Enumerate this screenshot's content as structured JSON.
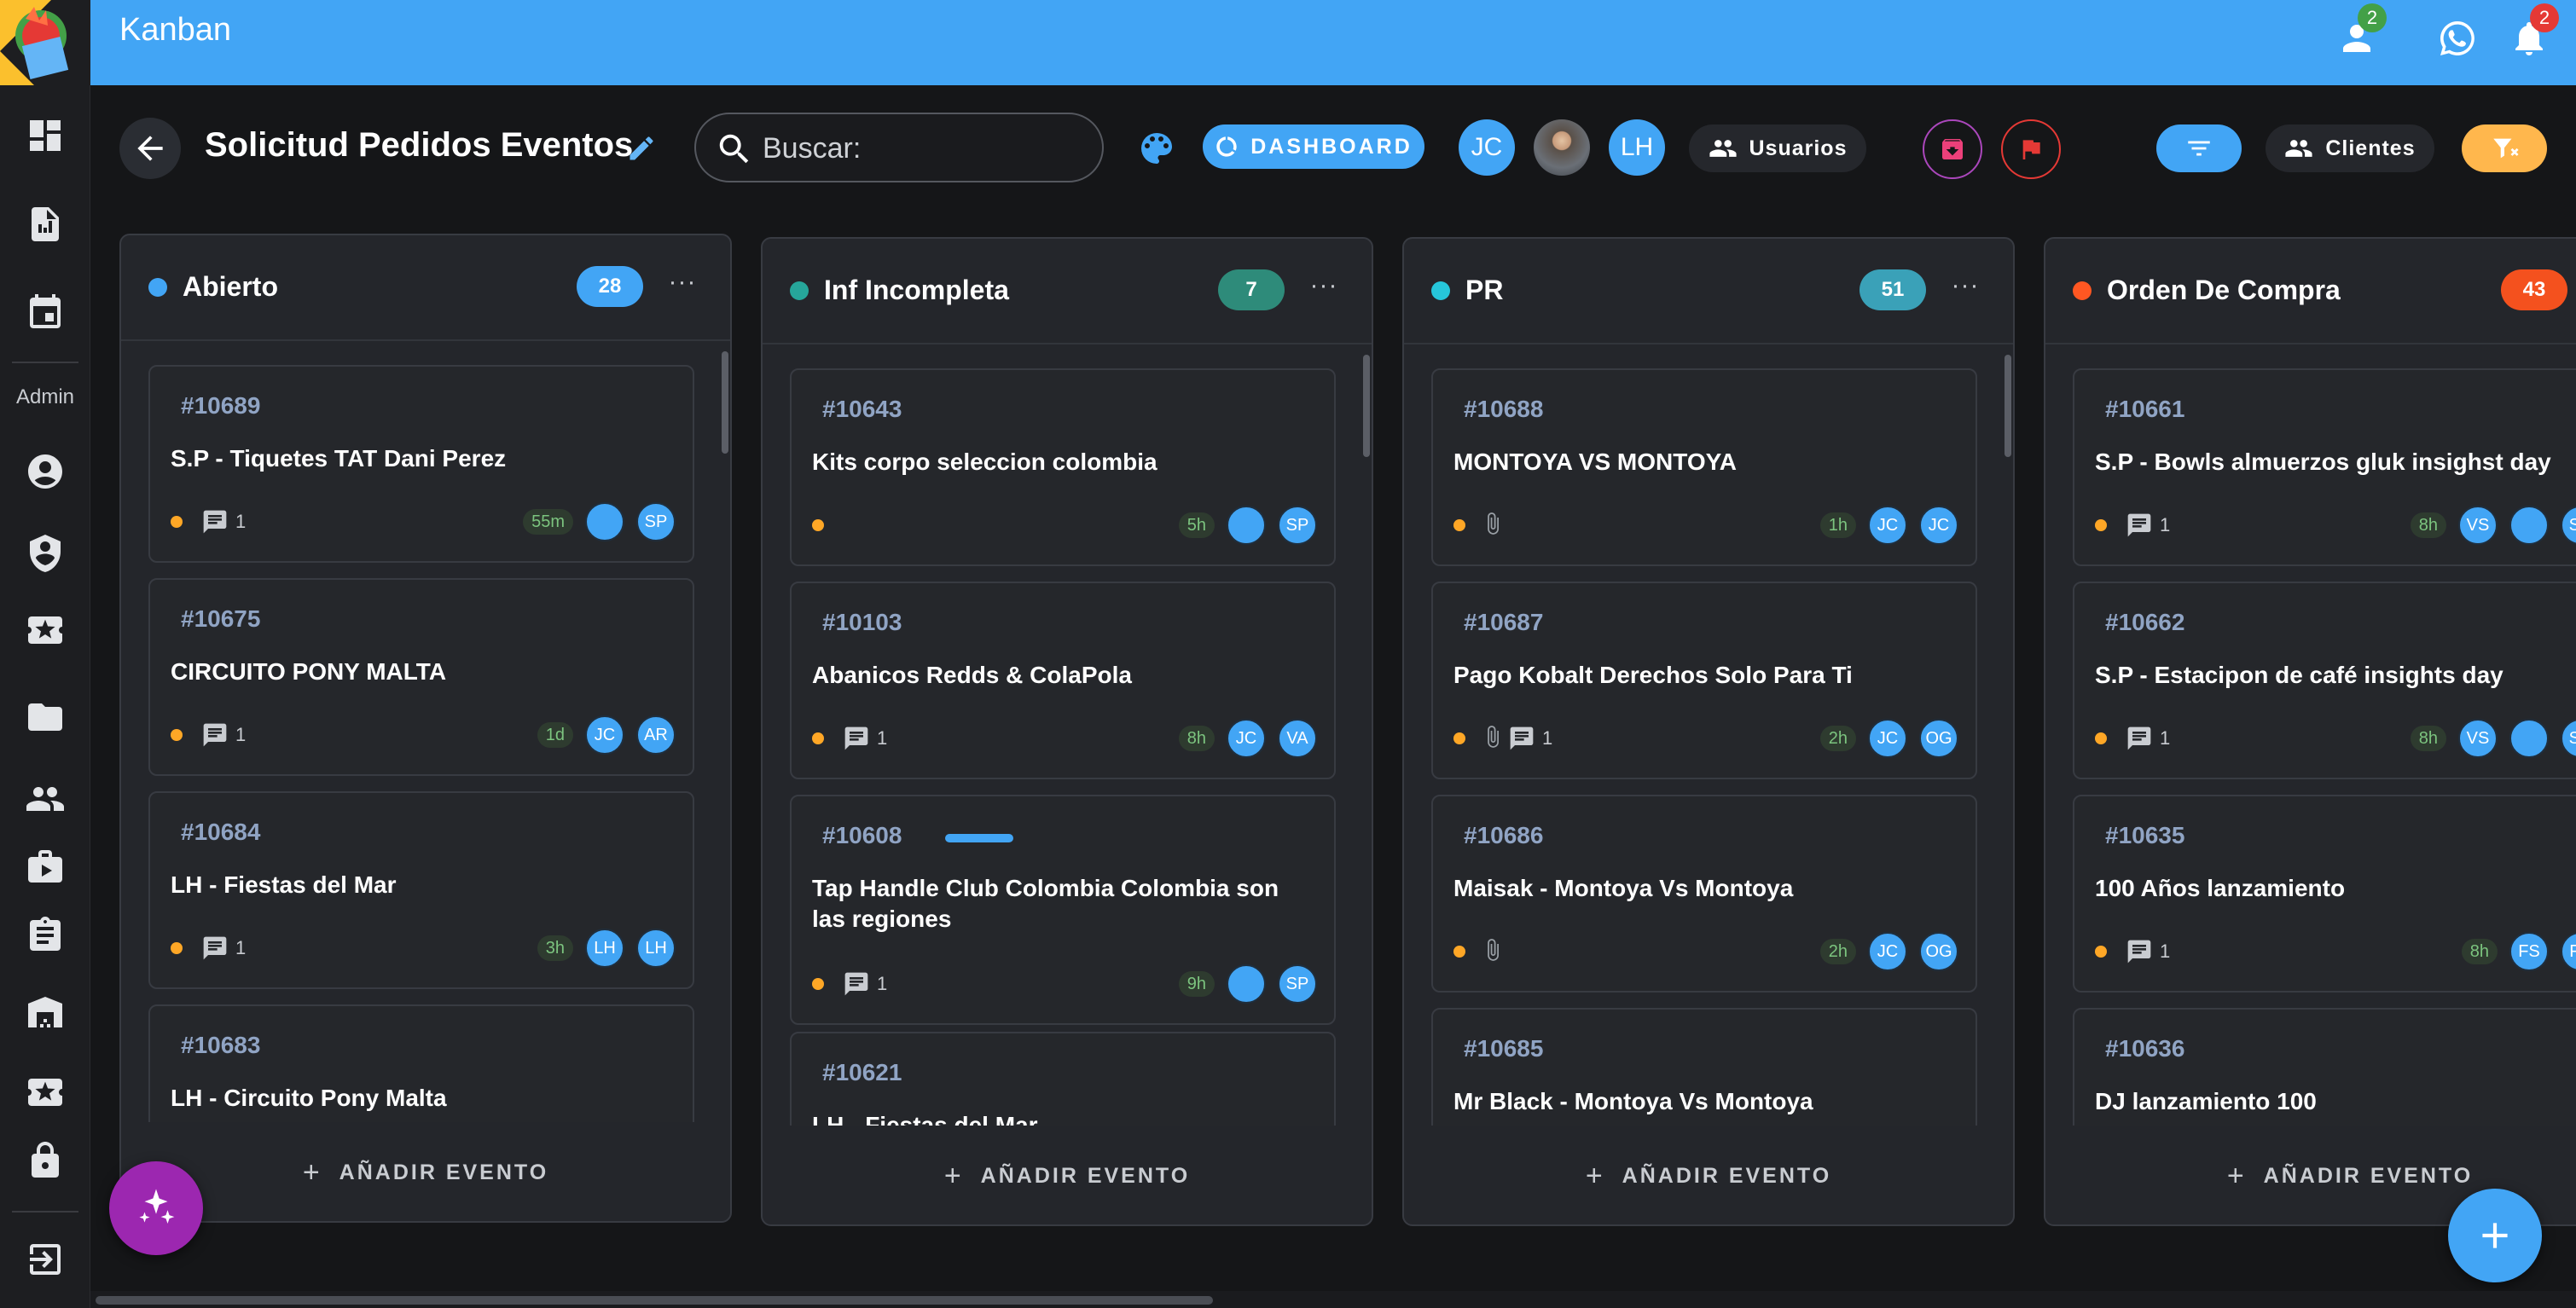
{
  "appbar": {
    "title": "Kanban",
    "contacts_badge": "2",
    "notifications_badge": "2"
  },
  "sidebar": {
    "admin_label": "Admin"
  },
  "toolbar": {
    "board_title": "Solicitud Pedidos Eventos",
    "search_placeholder": "Buscar:",
    "dashboard_label": "DASHBOARD",
    "users_label": "Usuarios",
    "clients_label": "Clientes",
    "avatars": [
      {
        "initials": "JC",
        "kind": "initials"
      },
      {
        "initials": "",
        "kind": "photo"
      },
      {
        "initials": "LH",
        "kind": "initials"
      }
    ]
  },
  "colors": {
    "accent": "#42a5f5",
    "col_abierto": "#42a5f5",
    "col_inf": "#26a69a",
    "col_pr": "#26c6da",
    "col_orden": "#ff5722",
    "priority": "#ffa726"
  },
  "add_label": "AÑADIR EVENTO",
  "columns": [
    {
      "title": "Abierto",
      "count": "28",
      "dot_color": "#42a5f5",
      "count_color": "#42a5f5",
      "cards": [
        {
          "id": "#10689",
          "title": "S.P - Tiquetes TAT Dani Perez",
          "comments": "1",
          "attachment": false,
          "bar": false,
          "age": "55m",
          "avatars": [
            {
              "kind": "photo",
              "initials": ""
            },
            {
              "kind": "initials",
              "initials": "SP"
            }
          ]
        },
        {
          "id": "#10675",
          "title": "CIRCUITO PONY MALTA",
          "comments": "1",
          "attachment": false,
          "bar": false,
          "age": "1d",
          "avatars": [
            {
              "kind": "initials",
              "initials": "JC"
            },
            {
              "kind": "initials",
              "initials": "AR"
            }
          ]
        },
        {
          "id": "#10684",
          "title": "LH - Fiestas del Mar",
          "comments": "1",
          "attachment": false,
          "bar": false,
          "age": "3h",
          "avatars": [
            {
              "kind": "initials",
              "initials": "LH"
            },
            {
              "kind": "initials",
              "initials": "LH"
            }
          ]
        },
        {
          "id": "#10683",
          "title": "LH - Circuito Pony Malta",
          "comments": "",
          "attachment": false,
          "bar": false,
          "age": "",
          "avatars": []
        }
      ]
    },
    {
      "title": "Inf Incompleta",
      "count": "7",
      "dot_color": "#26a69a",
      "count_color": "#2e8b7a",
      "cards": [
        {
          "id": "#10643",
          "title": "Kits corpo seleccion colombia",
          "comments": "",
          "attachment": false,
          "bar": false,
          "age": "5h",
          "avatars": [
            {
              "kind": "photo",
              "initials": ""
            },
            {
              "kind": "initials",
              "initials": "SP"
            }
          ]
        },
        {
          "id": "#10103",
          "title": "Abanicos Redds & ColaPola",
          "comments": "1",
          "attachment": false,
          "bar": false,
          "age": "8h",
          "avatars": [
            {
              "kind": "initials",
              "initials": "JC"
            },
            {
              "kind": "initials",
              "initials": "VA"
            }
          ]
        },
        {
          "id": "#10608",
          "title": "Tap Handle Club Colombia Colombia son las regiones",
          "comments": "1",
          "attachment": false,
          "bar": true,
          "age": "9h",
          "avatars": [
            {
              "kind": "photo",
              "initials": ""
            },
            {
              "kind": "initials",
              "initials": "SP"
            }
          ]
        },
        {
          "id": "#10621",
          "title": "LH - Fiestas del Mar",
          "comments": "",
          "attachment": false,
          "bar": false,
          "age": "",
          "avatars": []
        }
      ]
    },
    {
      "title": "PR",
      "count": "51",
      "dot_color": "#26c6da",
      "count_color": "#3aa1b8",
      "cards": [
        {
          "id": "#10688",
          "title": "MONTOYA VS MONTOYA",
          "comments": "",
          "attachment": true,
          "bar": false,
          "age": "1h",
          "avatars": [
            {
              "kind": "initials",
              "initials": "JC"
            },
            {
              "kind": "initials",
              "initials": "JC"
            }
          ]
        },
        {
          "id": "#10687",
          "title": "Pago Kobalt Derechos Solo Para Ti",
          "comments": "1",
          "attachment": true,
          "bar": false,
          "age": "2h",
          "avatars": [
            {
              "kind": "initials",
              "initials": "JC"
            },
            {
              "kind": "initials",
              "initials": "OG"
            }
          ]
        },
        {
          "id": "#10686",
          "title": "Maisak - Montoya Vs Montoya",
          "comments": "",
          "attachment": true,
          "bar": false,
          "age": "2h",
          "avatars": [
            {
              "kind": "initials",
              "initials": "JC"
            },
            {
              "kind": "initials",
              "initials": "OG"
            }
          ]
        },
        {
          "id": "#10685",
          "title": "Mr Black - Montoya Vs Montoya",
          "comments": "",
          "attachment": false,
          "bar": false,
          "age": "",
          "avatars": []
        }
      ]
    },
    {
      "title": "Orden De Compra",
      "count": "43",
      "dot_color": "#ff5722",
      "count_color": "#f4511e",
      "cards": [
        {
          "id": "#10661",
          "title": "S.P - Bowls almuerzos gluk insighst day",
          "comments": "1",
          "attachment": false,
          "bar": false,
          "age": "8h",
          "avatars": [
            {
              "kind": "initials",
              "initials": "VS"
            },
            {
              "kind": "photo",
              "initials": ""
            },
            {
              "kind": "initials",
              "initials": "SP"
            }
          ]
        },
        {
          "id": "#10662",
          "title": "S.P - Estacipon de café insights day",
          "comments": "1",
          "attachment": false,
          "bar": false,
          "age": "8h",
          "avatars": [
            {
              "kind": "initials",
              "initials": "VS"
            },
            {
              "kind": "photo",
              "initials": ""
            },
            {
              "kind": "initials",
              "initials": "SP"
            }
          ]
        },
        {
          "id": "#10635",
          "title": "100 Años lanzamiento",
          "comments": "1",
          "attachment": false,
          "bar": false,
          "age": "8h",
          "avatars": [
            {
              "kind": "initials",
              "initials": "FS"
            },
            {
              "kind": "initials",
              "initials": "FS"
            }
          ]
        },
        {
          "id": "#10636",
          "title": "DJ lanzamiento 100",
          "comments": "",
          "attachment": false,
          "bar": false,
          "age": "",
          "avatars": []
        }
      ]
    }
  ]
}
